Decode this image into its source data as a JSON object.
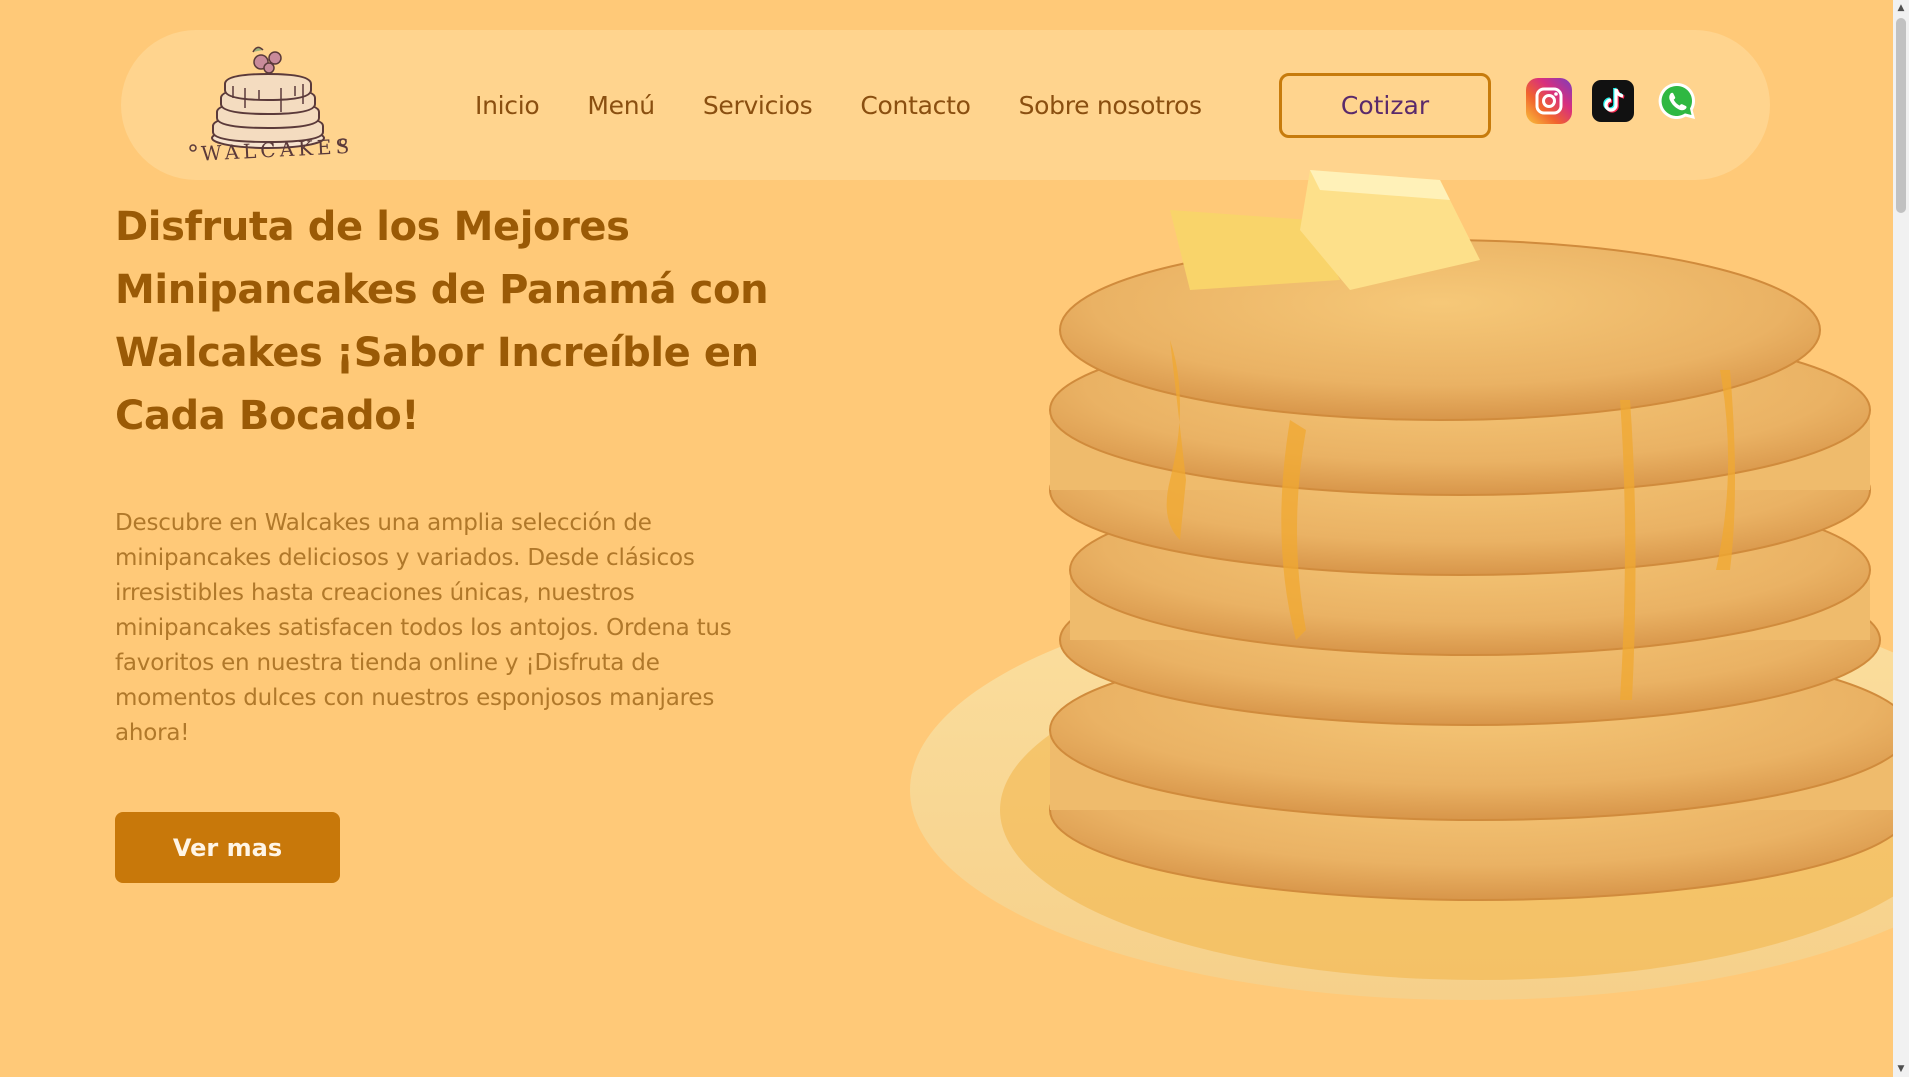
{
  "header": {
    "logo_text": "WALCAKES",
    "nav": [
      {
        "label": "Inicio"
      },
      {
        "label": "Menú"
      },
      {
        "label": "Servicios"
      },
      {
        "label": "Contacto"
      },
      {
        "label": "Sobre nosotros"
      }
    ],
    "cotizar_label": "Cotizar",
    "social": [
      {
        "icon": "instagram-icon"
      },
      {
        "icon": "tiktok-icon"
      },
      {
        "icon": "whatsapp-icon"
      }
    ]
  },
  "hero": {
    "title": "Disfruta de los Mejores Minipancakes de Panamá con Walcakes ¡Sabor Increíble en Cada Bocado!",
    "description": "Descubre en Walcakes una amplia selección de minipancakes deliciosos y variados. Desde clásicos irresistibles hasta creaciones únicas, nuestros minipancakes satisfacen todos los antojos. Ordena tus favoritos en nuestra tienda online y ¡Disfruta de momentos dulces con nuestros esponjosos manjares ahora!",
    "cta_label": "Ver mas"
  },
  "colors": {
    "background": "#ffc978",
    "header_bg": "#ffd48e",
    "title": "#9a5a06",
    "body_text": "#b0782a",
    "button": "#c8780a"
  }
}
